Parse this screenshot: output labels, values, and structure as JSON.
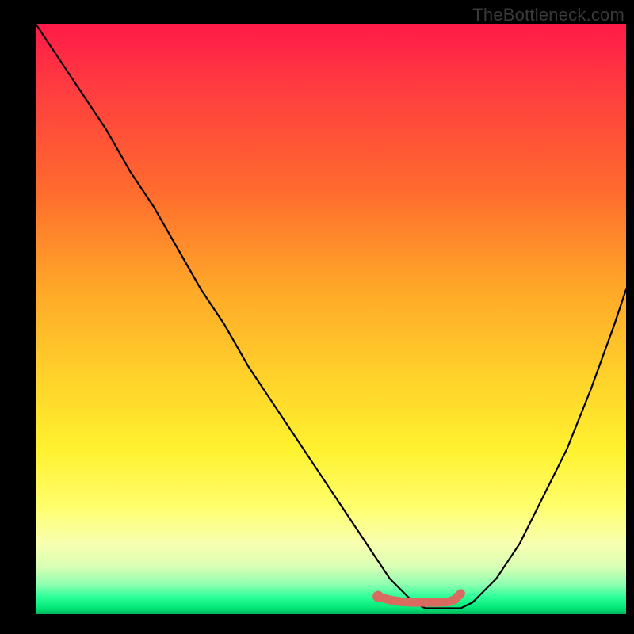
{
  "watermark": "TheBottleneck.com",
  "chart_data": {
    "type": "line",
    "title": "",
    "xlabel": "",
    "ylabel": "",
    "xlim": [
      0,
      100
    ],
    "ylim": [
      0,
      100
    ],
    "series": [
      {
        "name": "bottleneck-curve",
        "x": [
          0,
          4,
          8,
          12,
          16,
          20,
          24,
          28,
          32,
          36,
          40,
          44,
          48,
          52,
          56,
          58,
          60,
          62,
          64,
          66,
          68,
          70,
          72,
          74,
          78,
          82,
          86,
          90,
          94,
          98,
          100
        ],
        "y": [
          100,
          94,
          88,
          82,
          75,
          69,
          62,
          55,
          49,
          42,
          36,
          30,
          24,
          18,
          12,
          9,
          6,
          4,
          2,
          1,
          1,
          1,
          1,
          2,
          6,
          12,
          20,
          28,
          38,
          49,
          55
        ]
      }
    ],
    "highlight_segment": {
      "name": "optimal-range",
      "color": "#d86a60",
      "x": [
        58,
        60,
        62,
        64,
        66,
        68,
        70,
        71,
        72
      ],
      "y": [
        3,
        2.4,
        2.1,
        2.0,
        2.0,
        2.0,
        2.1,
        2.5,
        3.5
      ]
    },
    "marker": {
      "name": "selected-point",
      "color": "#d86a60",
      "x": 58,
      "y": 3
    }
  },
  "colors": {
    "curve": "#000000",
    "highlight": "#d86a60",
    "marker": "#d86a60"
  }
}
